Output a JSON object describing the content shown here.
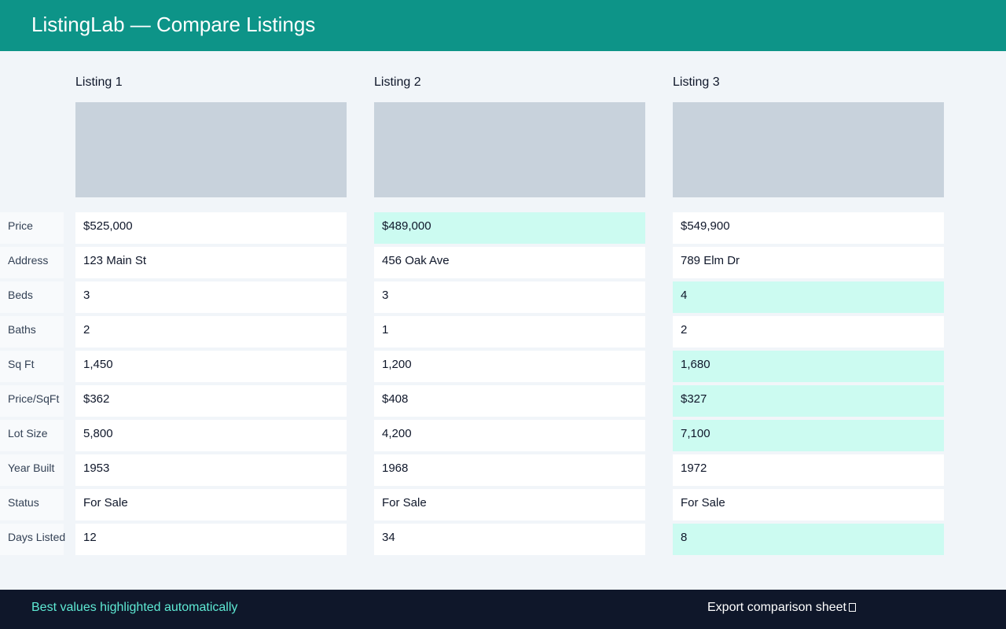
{
  "header": {
    "title": "ListingLab — Compare Listings"
  },
  "listings": [
    {
      "label": "Listing 1"
    },
    {
      "label": "Listing 2"
    },
    {
      "label": "Listing 3"
    }
  ],
  "rows": [
    {
      "label": "Price",
      "values": [
        "$525,000",
        "$489,000",
        "$549,900"
      ],
      "best": [
        false,
        true,
        false
      ]
    },
    {
      "label": "Address",
      "values": [
        "123 Main St",
        "456 Oak Ave",
        "789 Elm Dr"
      ],
      "best": [
        false,
        false,
        false
      ]
    },
    {
      "label": "Beds",
      "values": [
        "3",
        "3",
        "4"
      ],
      "best": [
        false,
        false,
        true
      ]
    },
    {
      "label": "Baths",
      "values": [
        "2",
        "1",
        "2"
      ],
      "best": [
        false,
        false,
        false
      ]
    },
    {
      "label": "Sq Ft",
      "values": [
        "1,450",
        "1,200",
        "1,680"
      ],
      "best": [
        false,
        false,
        true
      ]
    },
    {
      "label": "Price/SqFt",
      "values": [
        "$362",
        "$408",
        "$327"
      ],
      "best": [
        false,
        false,
        true
      ]
    },
    {
      "label": "Lot Size",
      "values": [
        "5,800",
        "4,200",
        "7,100"
      ],
      "best": [
        false,
        false,
        true
      ]
    },
    {
      "label": "Year Built",
      "values": [
        "1953",
        "1968",
        "1972"
      ],
      "best": [
        false,
        false,
        false
      ]
    },
    {
      "label": "Status",
      "values": [
        "For Sale",
        "For Sale",
        "For Sale"
      ],
      "best": [
        false,
        false,
        false
      ]
    },
    {
      "label": "Days Listed",
      "values": [
        "12",
        "34",
        "8"
      ],
      "best": [
        false,
        false,
        true
      ]
    }
  ],
  "footer": {
    "note": "Best values highlighted automatically",
    "export_label": "Export comparison sheet",
    "export_icon": "external-link-icon"
  },
  "colors": {
    "header_bg": "#0d9488",
    "footer_bg": "#0f172a",
    "best_highlight": "#ccfbf1",
    "note_text": "#5eead4"
  }
}
